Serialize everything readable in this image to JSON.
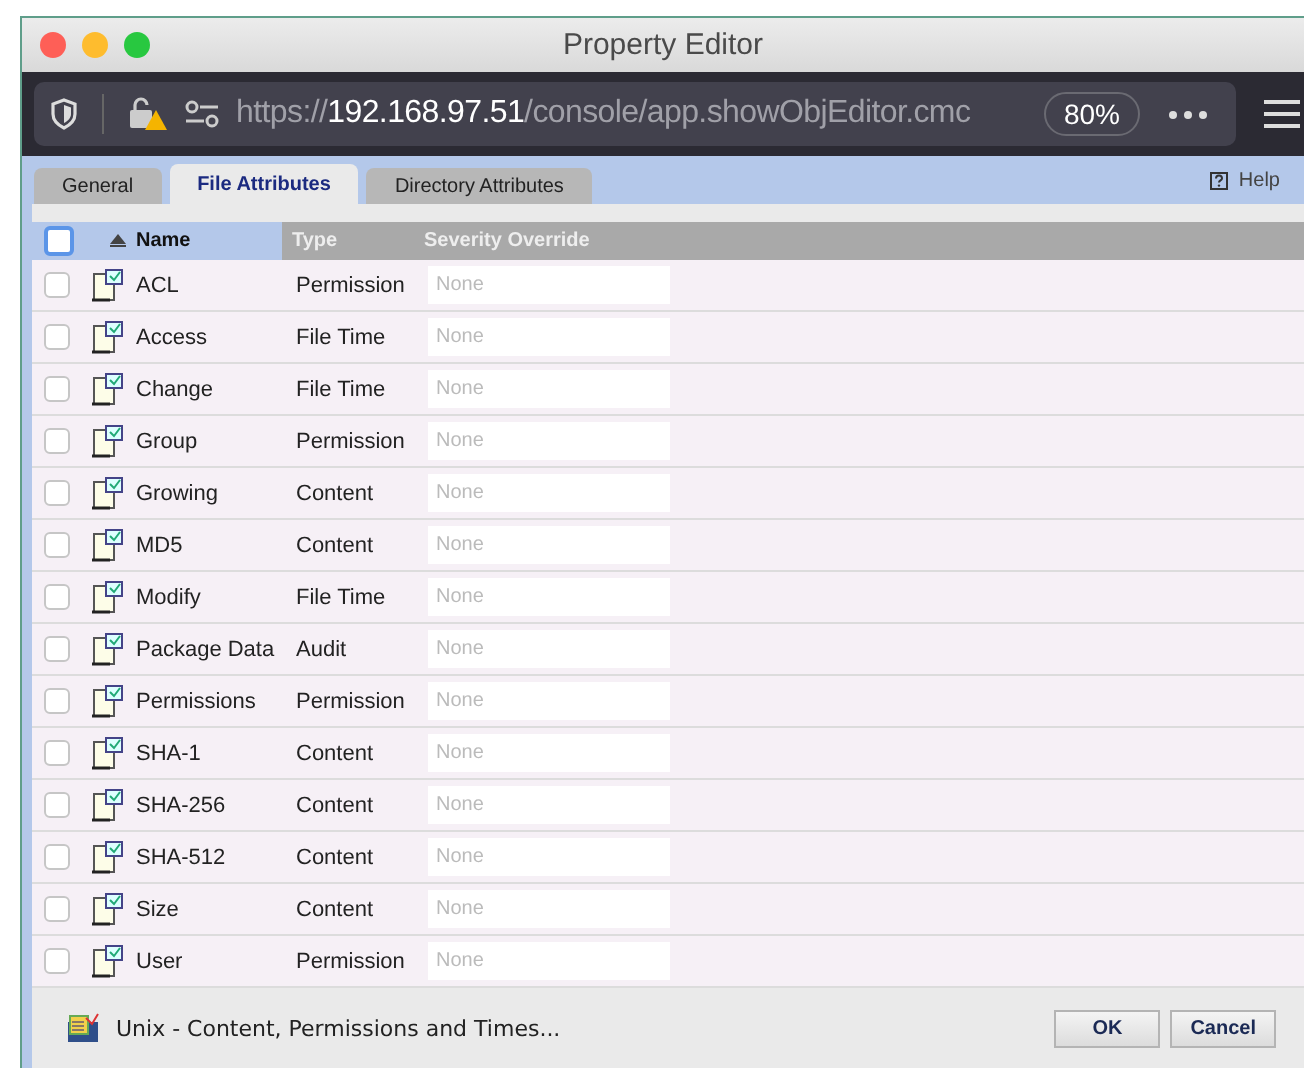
{
  "window": {
    "title": "Property Editor"
  },
  "browser": {
    "url_scheme": "https://",
    "url_host": "192.168.97.51",
    "url_path": "/console/app.showObjEditor.cmc",
    "zoom": "80%"
  },
  "tabs": [
    {
      "label": "General",
      "selected": false
    },
    {
      "label": "File Attributes",
      "selected": true
    },
    {
      "label": "Directory Attributes",
      "selected": false
    }
  ],
  "help": "Help",
  "table": {
    "select_all": {
      "checked": false
    },
    "columns": [
      {
        "label": "Name",
        "sorted": true
      },
      {
        "label": "Type",
        "sorted": false
      },
      {
        "label": "Severity Override",
        "sorted": false
      }
    ],
    "rows": [
      {
        "name": "ACL",
        "type": "Permission",
        "severity": {
          "placeholder": "None"
        },
        "checked": false
      },
      {
        "name": "Access",
        "type": "File Time",
        "severity": {
          "placeholder": "None"
        },
        "checked": false
      },
      {
        "name": "Change",
        "type": "File Time",
        "severity": {
          "placeholder": "None"
        },
        "checked": false
      },
      {
        "name": "Group",
        "type": "Permission",
        "severity": {
          "placeholder": "None"
        },
        "checked": false
      },
      {
        "name": "Growing",
        "type": "Content",
        "severity": {
          "placeholder": "None"
        },
        "checked": false
      },
      {
        "name": "MD5",
        "type": "Content",
        "severity": {
          "placeholder": "None"
        },
        "checked": false
      },
      {
        "name": "Modify",
        "type": "File Time",
        "severity": {
          "placeholder": "None"
        },
        "checked": false
      },
      {
        "name": "Package Data",
        "type": "Audit",
        "severity": {
          "placeholder": "None"
        },
        "checked": false
      },
      {
        "name": "Permissions",
        "type": "Permission",
        "severity": {
          "placeholder": "None"
        },
        "checked": false
      },
      {
        "name": "SHA-1",
        "type": "Content",
        "severity": {
          "placeholder": "None"
        },
        "checked": false
      },
      {
        "name": "SHA-256",
        "type": "Content",
        "severity": {
          "placeholder": "None"
        },
        "checked": false
      },
      {
        "name": "SHA-512",
        "type": "Content",
        "severity": {
          "placeholder": "None"
        },
        "checked": false
      },
      {
        "name": "Size",
        "type": "Content",
        "severity": {
          "placeholder": "None"
        },
        "checked": false
      },
      {
        "name": "User",
        "type": "Permission",
        "severity": {
          "placeholder": "None"
        },
        "checked": false
      }
    ]
  },
  "footer": {
    "template": "Unix - Content, Permissions and Times...",
    "buttons": [
      "OK",
      "Cancel"
    ]
  }
}
